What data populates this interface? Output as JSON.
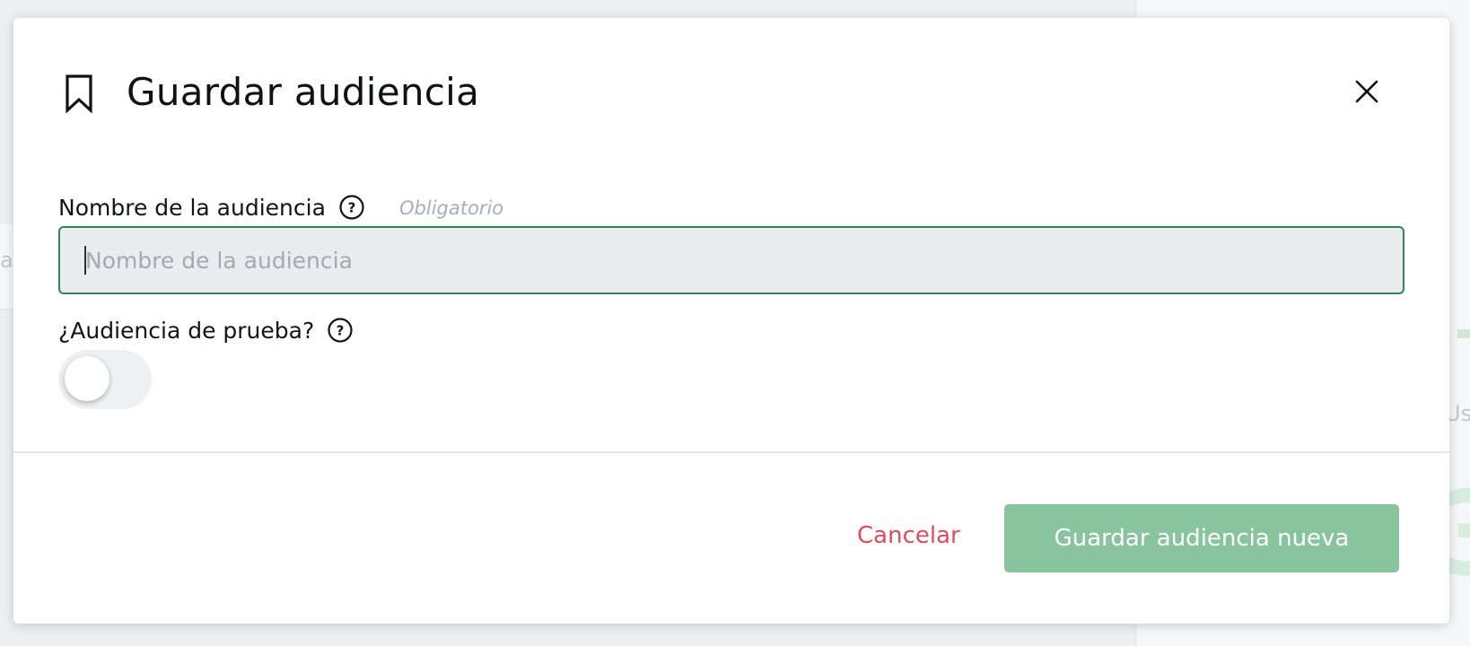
{
  "modal": {
    "title": "Guardar audiencia",
    "icon": "bookmark-icon",
    "close_icon": "close-icon"
  },
  "name_field": {
    "label": "Nombre de la audiencia",
    "hint": "Obligatorio",
    "placeholder": "Nombre de la audiencia",
    "value": ""
  },
  "test_field": {
    "label": "¿Audiencia de prueba?",
    "enabled": false
  },
  "footer": {
    "cancel_label": "Cancelar",
    "save_label": "Guardar audiencia nueva"
  },
  "background": {
    "partial_left": "a",
    "partial_right": "Us",
    "partial_digit": "3"
  },
  "colors": {
    "accent_green": "#2e8a4f",
    "save_button": "#88c49d",
    "cancel_text": "#e04a5f"
  }
}
